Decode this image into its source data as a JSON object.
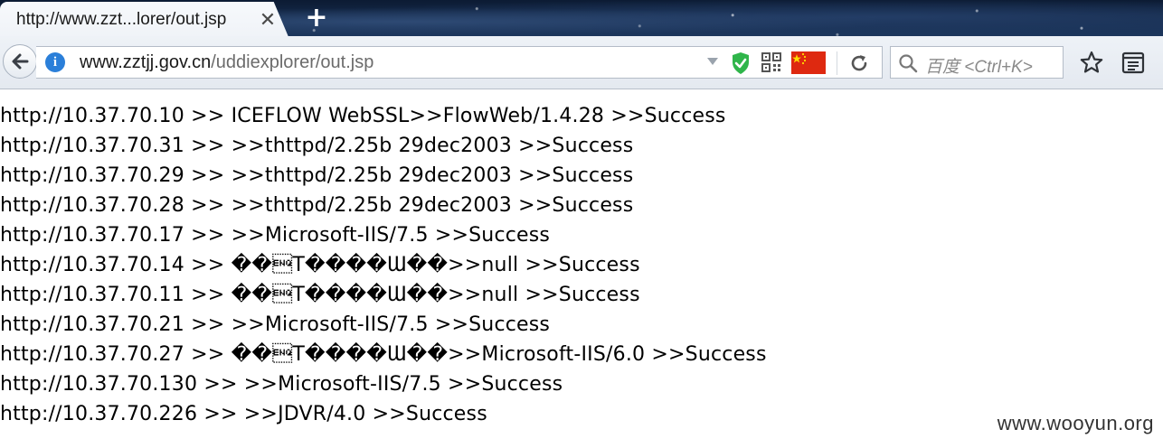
{
  "tab": {
    "title": "http://www.zzt...lorer/out.jsp",
    "close_glyph": "✕",
    "new_tab_glyph": "+"
  },
  "toolbar": {
    "url_host": "www.zztjj.gov.cn",
    "url_path": "/uddiexplorer/out.jsp",
    "search_placeholder": "百度 <Ctrl+K>"
  },
  "colors": {
    "accent": "#2b7fd9",
    "shield": "#2fb54a",
    "flag": "#de2910"
  },
  "icons": [
    "back-arrow-icon",
    "info-icon",
    "shield-icon",
    "qr-code-icon",
    "china-flag-icon",
    "reload-icon",
    "search-icon",
    "star-icon",
    "reader-list-icon"
  ],
  "content": {
    "lines": [
      "http://10.37.70.10 >> ICEFLOW WebSSL>>FlowWeb/1.4.28 >>Success",
      "http://10.37.70.31 >> >>thttpd/2.25b 29dec2003 >>Success",
      "http://10.37.70.29 >> >>thttpd/2.25b 29dec2003 >>Success",
      "http://10.37.70.28 >> >>thttpd/2.25b 29dec2003 >>Success",
      "http://10.37.70.17 >> >>Microsoft-IIS/7.5 >>Success",
      "http://10.37.70.14 >> ��\u0005T����Ɯ��>>null >>Success",
      "http://10.37.70.11 >> ��\u0005T����Ɯ��>>null >>Success",
      "http://10.37.70.21 >> >>Microsoft-IIS/7.5 >>Success",
      "http://10.37.70.27 >> ��\u0005T����Ɯ��>>Microsoft-IIS/6.0 >>Success",
      "http://10.37.70.130 >> >>Microsoft-IIS/7.5 >>Success",
      "http://10.37.70.226 >> >>JDVR/4.0 >>Success"
    ],
    "watermark": "www.wooyun.org"
  }
}
